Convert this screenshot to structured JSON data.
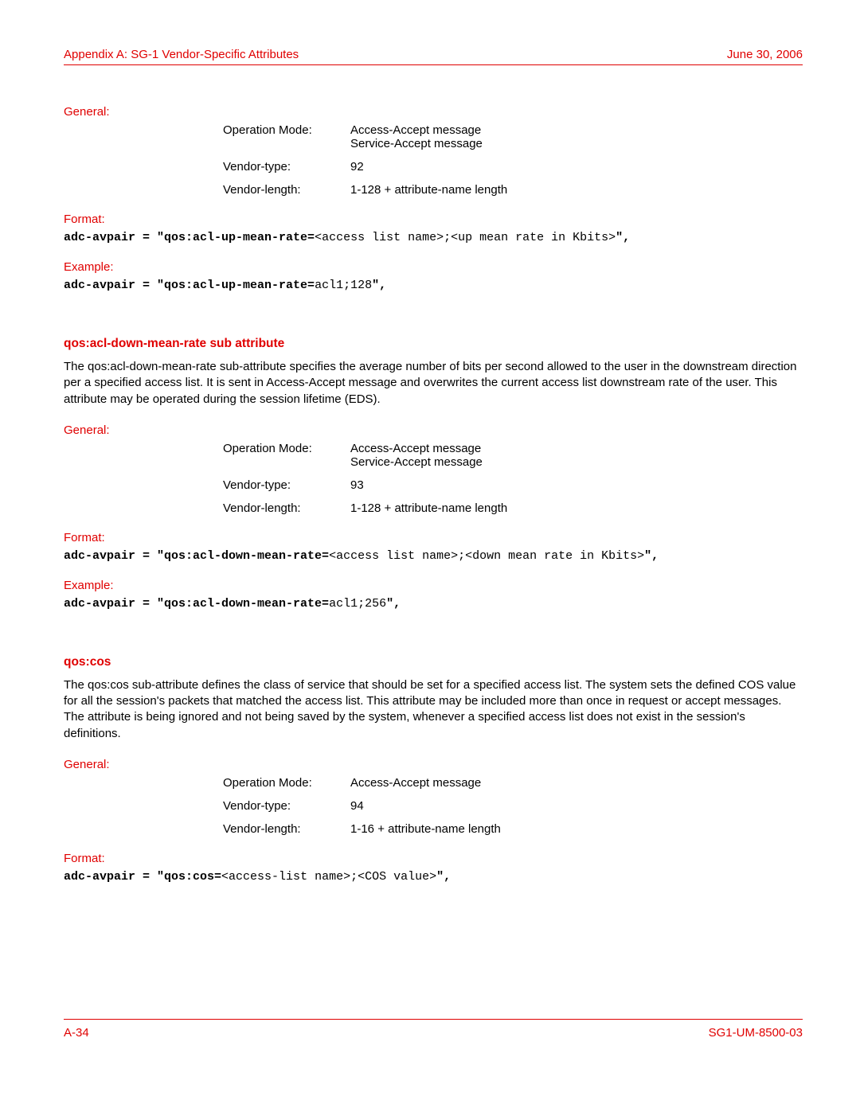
{
  "header": {
    "left": "Appendix A: SG-1 Vendor-Specific Attributes",
    "right": "June 30, 2006"
  },
  "sec1": {
    "general_label": "General:",
    "rows": [
      {
        "k": "Operation Mode:",
        "v": "Access-Accept message\nService-Accept message"
      },
      {
        "k": "Vendor-type:",
        "v": "92"
      },
      {
        "k": "Vendor-length:",
        "v": "1-128 + attribute-name length"
      }
    ],
    "format_label": "Format:",
    "format_bold": "adc-avpair = \"qos:acl-up-mean-rate=",
    "format_param": "<access list name>;<up mean rate in Kbits>",
    "format_tail": "\",",
    "example_label": "Example:",
    "example_bold": "adc-avpair = \"qos:acl-up-mean-rate=",
    "example_param": "acl1;128",
    "example_tail": "\","
  },
  "sec2": {
    "heading": "qos:acl-down-mean-rate sub attribute",
    "desc": "The qos:acl-down-mean-rate sub-attribute specifies the average number of bits per second allowed to the user in the downstream direction per a specified access list. It is sent in Access-Accept message and overwrites the current access list downstream rate of the user. This attribute may be operated during the session lifetime (EDS).",
    "general_label": "General:",
    "rows": [
      {
        "k": "Operation Mode:",
        "v": "Access-Accept message\nService-Accept message"
      },
      {
        "k": "Vendor-type:",
        "v": "93"
      },
      {
        "k": "Vendor-length:",
        "v": "1-128 + attribute-name length"
      }
    ],
    "format_label": "Format:",
    "format_bold": "adc-avpair = \"qos:acl-down-mean-rate=",
    "format_param": "<access list name>;<down mean rate in Kbits>",
    "format_tail": "\",",
    "example_label": "Example:",
    "example_bold": "adc-avpair = \"qos:acl-down-mean-rate=",
    "example_param": "acl1;256",
    "example_tail": "\","
  },
  "sec3": {
    "heading": "qos:cos",
    "desc": "The qos:cos sub-attribute defines the class of service that should be set for a specified access list. The system sets the defined COS value for all the session's packets that matched the access list. This attribute may be included more than once in request or accept messages. The attribute is being ignored and not being saved by the system, whenever a specified access list does not exist in the session's definitions.",
    "general_label": "General:",
    "rows": [
      {
        "k": "Operation Mode:",
        "v": "Access-Accept message"
      },
      {
        "k": "Vendor-type:",
        "v": "94"
      },
      {
        "k": "Vendor-length:",
        "v": "1-16 + attribute-name length"
      }
    ],
    "format_label": "Format:",
    "format_bold": "adc-avpair = \"qos:cos=",
    "format_param": "<access-list name>;<COS value>",
    "format_tail": "\","
  },
  "footer": {
    "left": "A-34",
    "right": "SG1-UM-8500-03"
  }
}
